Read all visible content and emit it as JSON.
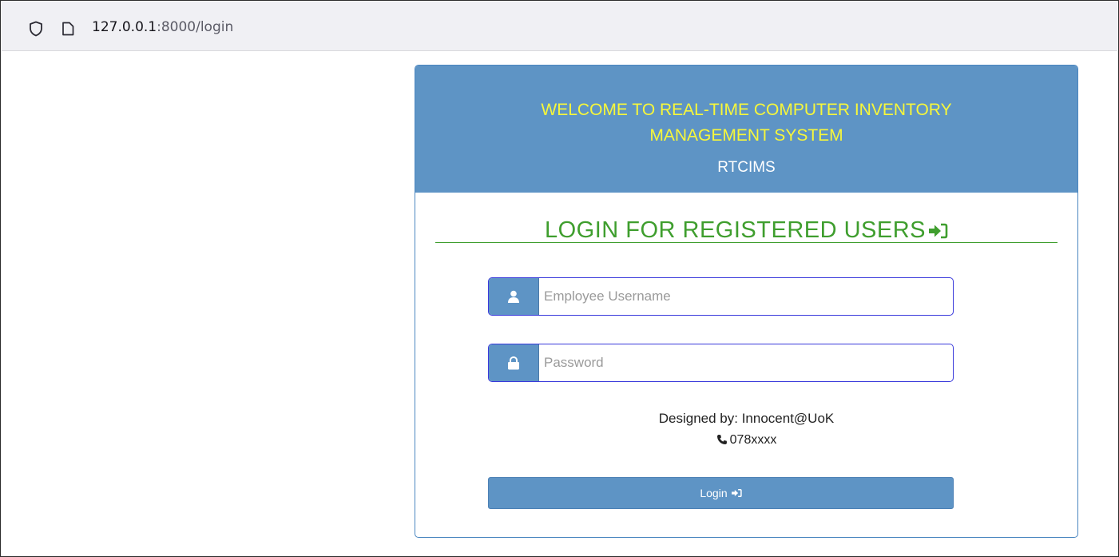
{
  "browser": {
    "url_host": "127.0.0.1",
    "url_rest": ":8000/login"
  },
  "header": {
    "welcome_line1": "WELCOME TO REAL-TIME COMPUTER INVENTORY",
    "welcome_line2": "MANAGEMENT SYSTEM",
    "abbreviation": "RTCIMS"
  },
  "login": {
    "title": "LOGIN FOR REGISTERED USERS",
    "username_placeholder": "Employee Username",
    "password_placeholder": "Password",
    "username_value": "",
    "password_value": "",
    "button_label": "Login"
  },
  "footer": {
    "designed_by": "Designed by: Innocent@UoK",
    "phone": "078xxxx"
  },
  "colors": {
    "header_bg": "#5e94c5",
    "welcome_text": "#f7f73a",
    "title_green": "#3f9e2e",
    "input_border": "#3a3adb"
  },
  "icons": {
    "tracking": "shield-icon",
    "page": "page-icon",
    "user": "user-icon",
    "lock": "lock-icon",
    "login_arrow": "sign-in-icon",
    "phone": "phone-icon"
  }
}
